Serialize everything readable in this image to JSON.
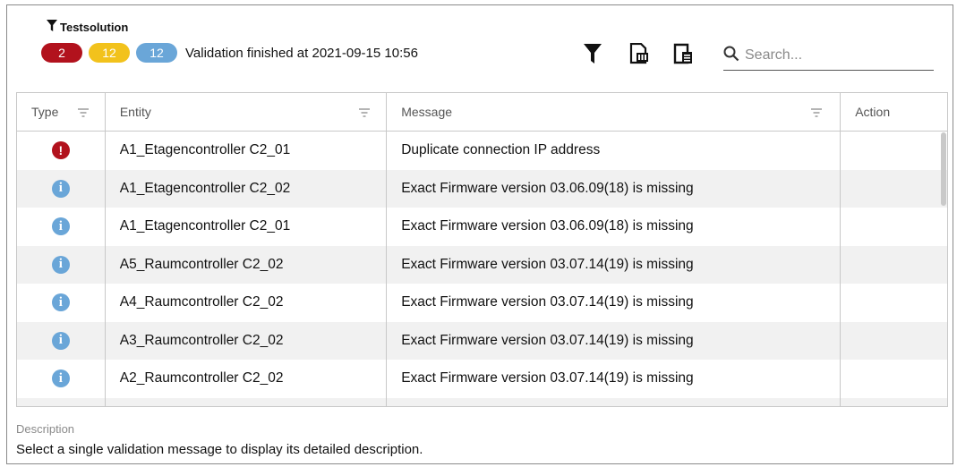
{
  "header": {
    "title": "Testsolution",
    "badges": {
      "error_count": "2",
      "warning_count": "12",
      "info_count": "12",
      "error_color": "#b2121d",
      "warning_color": "#f2c21c",
      "info_color": "#6aa6d8"
    },
    "status": "Validation finished at 2021-09-15 10:56"
  },
  "toolbar": {
    "icons": [
      "filter-icon",
      "export-file-icon",
      "document-list-icon"
    ]
  },
  "search": {
    "placeholder": "Search..."
  },
  "table": {
    "columns": [
      "Type",
      "Entity",
      "Message",
      "Action"
    ],
    "rows": [
      {
        "type": "error",
        "entity": "A1_Etagencontroller C2_01",
        "message": "Duplicate connection IP address",
        "action": ""
      },
      {
        "type": "info",
        "entity": "A1_Etagencontroller C2_02",
        "message": "Exact Firmware version 03.06.09(18) is missing",
        "action": ""
      },
      {
        "type": "info",
        "entity": "A1_Etagencontroller C2_01",
        "message": "Exact Firmware version 03.06.09(18) is missing",
        "action": ""
      },
      {
        "type": "info",
        "entity": "A5_Raumcontroller C2_02",
        "message": "Exact Firmware version 03.07.14(19) is missing",
        "action": ""
      },
      {
        "type": "info",
        "entity": "A4_Raumcontroller C2_02",
        "message": "Exact Firmware version 03.07.14(19) is missing",
        "action": ""
      },
      {
        "type": "info",
        "entity": "A3_Raumcontroller C2_02",
        "message": "Exact Firmware version 03.07.14(19) is missing",
        "action": ""
      },
      {
        "type": "info",
        "entity": "A2_Raumcontroller C2_02",
        "message": "Exact Firmware version 03.07.14(19) is missing",
        "action": ""
      }
    ]
  },
  "description": {
    "label": "Description",
    "text": "Select a single validation message to display its detailed description."
  }
}
